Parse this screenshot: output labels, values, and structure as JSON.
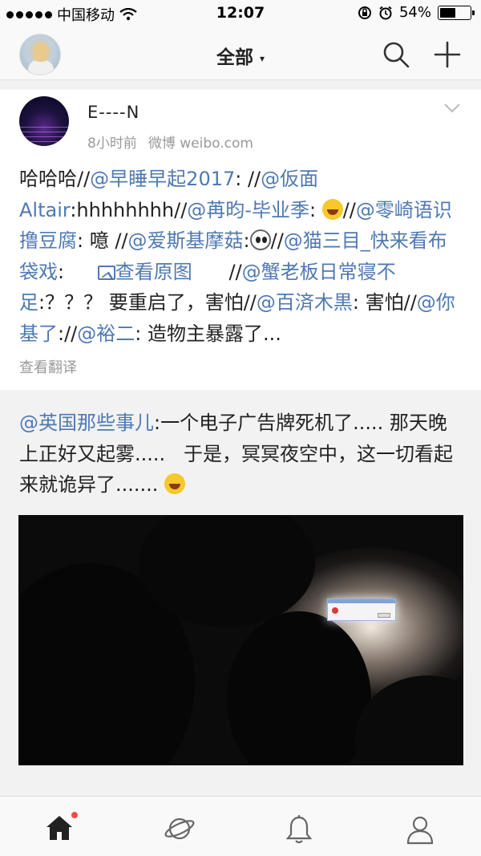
{
  "status_bar": {
    "carrier": "中国移动",
    "time": "12:07",
    "battery": "54%",
    "battery_level": 0.54
  },
  "navbar": {
    "title": "全部",
    "caret": "▾"
  },
  "post": {
    "author": "E----N",
    "time_ago": "8小时前",
    "source": "微博 weibo.com",
    "translate_label": "查看翻译",
    "image_link_label": "查看原图"
  },
  "colors": {
    "mention": "#4f79b3",
    "badge": "#f24b4b"
  },
  "icons": [
    "search-icon",
    "plus-icon",
    "chevron-down-icon",
    "home-icon",
    "discover-icon",
    "bell-icon",
    "profile-icon"
  ]
}
